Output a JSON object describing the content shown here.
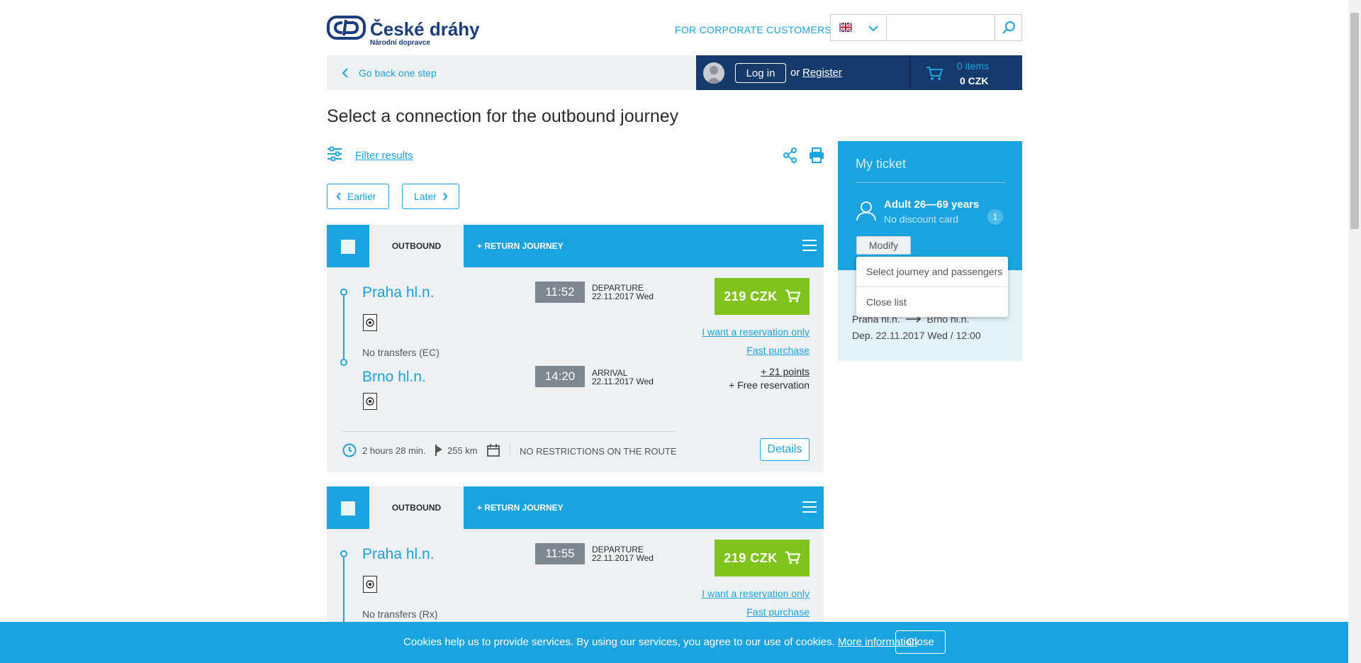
{
  "header": {
    "brand_name": "České dráhy",
    "brand_sub": "Národní dopravce",
    "corporate_link": "FOR CORPORATE CUSTOMERS",
    "language": "English",
    "search_placeholder": ""
  },
  "nav": {
    "back": "Go back one step",
    "login": "Log in",
    "or": "or",
    "register": "Register",
    "cart_count": "0 items",
    "cart_total": "0 CZK"
  },
  "page_title": "Select a connection for the outbound journey",
  "filter": {
    "label": "Filter results"
  },
  "paging": {
    "earlier": "Earlier",
    "later": "Later"
  },
  "connections": [
    {
      "tab_outbound": "OUTBOUND",
      "tab_return": "+ RETURN JOURNEY",
      "from": "Praha hl.n.",
      "to": "Brno hl.n.",
      "dep_time": "11:52",
      "dep_label": "DEPARTURE",
      "dep_date": "22.11.2017 Wed",
      "arr_time": "14:20",
      "arr_label": "ARRIVAL",
      "arr_date": "22.11.2017 Wed",
      "transfers": "No transfers (EC)",
      "price": "219 CZK",
      "reservation_link": "I want a reservation only",
      "fast_purchase": "Fast purchase",
      "points": "+ 21 points",
      "free_reservation": "+ Free reservation",
      "duration": "2 hours 28 min.",
      "distance": "255 km",
      "restrictions": "NO RESTRICTIONS ON THE ROUTE",
      "details": "Details"
    },
    {
      "tab_outbound": "OUTBOUND",
      "tab_return": "+ RETURN JOURNEY",
      "from": "Praha hl.n.",
      "dep_time": "11:55",
      "dep_label": "DEPARTURE",
      "dep_date": "22.11.2017 Wed",
      "transfers": "No transfers (Rx)",
      "price": "219 CZK",
      "reservation_link": "I want a reservation only",
      "fast_purchase": "Fast purchase"
    }
  ],
  "ticket": {
    "title": "My ticket",
    "passenger": "Adult 26—69 years",
    "discount": "No discount card",
    "count": "1",
    "modify": "Modify",
    "route_from": "Praha hl.n.",
    "route_to": "Brno hl.n.",
    "route_dep": "Dep. 22.11.2017 Wed / 12:00",
    "dropdown": [
      "Select journey and passengers",
      "Close list"
    ]
  },
  "cookie": {
    "text": "Cookies help us to provide services. By using our services, you agree to our use of cookies.",
    "more": "More information",
    "period": ".",
    "close": "Close"
  },
  "colors": {
    "accent": "#1aa3de",
    "navy": "#163a6c",
    "price_green": "#80c31c",
    "panel_gray": "#eef0f2"
  }
}
